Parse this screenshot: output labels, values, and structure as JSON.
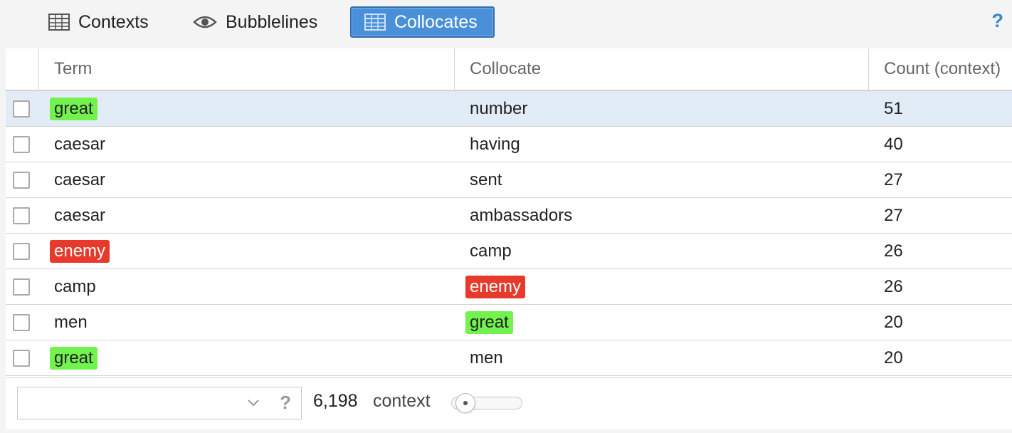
{
  "tabs": [
    {
      "label": "Contexts",
      "icon": "table-icon",
      "active": false
    },
    {
      "label": "Bubblelines",
      "icon": "eye-icon",
      "active": false
    },
    {
      "label": "Collocates",
      "icon": "table-icon",
      "active": true
    }
  ],
  "help_label": "?",
  "grid": {
    "columns": [
      "Term",
      "Collocate",
      "Count (context)"
    ],
    "rows": [
      {
        "term": "great",
        "collocate": "number",
        "count": "51",
        "term_highlight": "#72f24d",
        "collocate_highlight": "",
        "selected": true
      },
      {
        "term": "caesar",
        "collocate": "having",
        "count": "40",
        "term_highlight": "",
        "collocate_highlight": "",
        "selected": false
      },
      {
        "term": "caesar",
        "collocate": "sent",
        "count": "27",
        "term_highlight": "",
        "collocate_highlight": "",
        "selected": false
      },
      {
        "term": "caesar",
        "collocate": "ambassadors",
        "count": "27",
        "term_highlight": "",
        "collocate_highlight": "",
        "selected": false
      },
      {
        "term": "enemy",
        "collocate": "camp",
        "count": "26",
        "term_highlight": "#e83a2a",
        "collocate_highlight": "",
        "selected": false
      },
      {
        "term": "camp",
        "collocate": "enemy",
        "count": "26",
        "term_highlight": "",
        "collocate_highlight": "#e83a2a",
        "selected": false
      },
      {
        "term": "men",
        "collocate": "great",
        "count": "20",
        "term_highlight": "",
        "collocate_highlight": "#72f24d",
        "selected": false
      },
      {
        "term": "great",
        "collocate": "men",
        "count": "20",
        "term_highlight": "#72f24d",
        "collocate_highlight": "",
        "selected": false
      }
    ]
  },
  "footer": {
    "search_value": "",
    "help_label": "?",
    "total_count": "6,198",
    "context_label": "context",
    "context_slider_fraction": 0.05
  },
  "colors": {
    "accent": "#4a90d9",
    "highlight_green": "#72f24d",
    "highlight_red": "#e83a2a",
    "selected_row": "#e2ecf6"
  }
}
